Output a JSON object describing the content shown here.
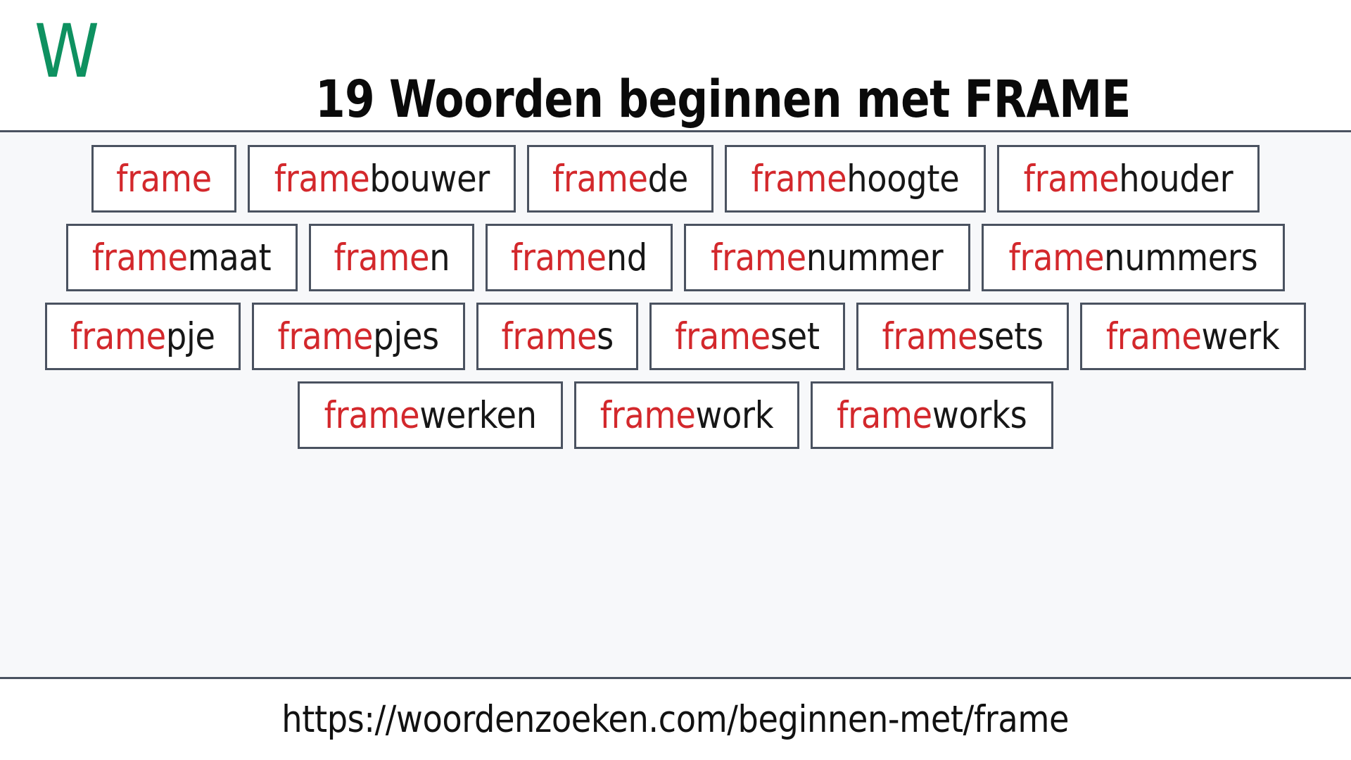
{
  "header": {
    "logo_letter": "W",
    "logo_color": "#0e9160",
    "title": "19 Woorden beginnen met FRAME"
  },
  "theme": {
    "highlight_color": "#d3282c",
    "text_color": "#161616",
    "border_color": "#4a5260",
    "content_background": "#f7f8fa",
    "header_background": "#ffffff"
  },
  "main": {
    "prefix": "frame",
    "word_count": 19,
    "rows": [
      [
        {
          "prefix": "frame",
          "suffix": ""
        },
        {
          "prefix": "frame",
          "suffix": "bouwer"
        },
        {
          "prefix": "frame",
          "suffix": "de"
        },
        {
          "prefix": "frame",
          "suffix": "hoogte"
        },
        {
          "prefix": "frame",
          "suffix": "houder"
        }
      ],
      [
        {
          "prefix": "frame",
          "suffix": "maat"
        },
        {
          "prefix": "frame",
          "suffix": "n"
        },
        {
          "prefix": "frame",
          "suffix": "nd"
        },
        {
          "prefix": "frame",
          "suffix": "nummer"
        },
        {
          "prefix": "frame",
          "suffix": "nummers"
        }
      ],
      [
        {
          "prefix": "frame",
          "suffix": "pje"
        },
        {
          "prefix": "frame",
          "suffix": "pjes"
        },
        {
          "prefix": "frame",
          "suffix": "s"
        },
        {
          "prefix": "frame",
          "suffix": "set"
        },
        {
          "prefix": "frame",
          "suffix": "sets"
        },
        {
          "prefix": "frame",
          "suffix": "werk"
        }
      ],
      [
        {
          "prefix": "frame",
          "suffix": "werken"
        },
        {
          "prefix": "frame",
          "suffix": "work"
        },
        {
          "prefix": "frame",
          "suffix": "works"
        }
      ]
    ]
  },
  "footer": {
    "url": "https://woordenzoeken.com/beginnen-met/frame"
  }
}
